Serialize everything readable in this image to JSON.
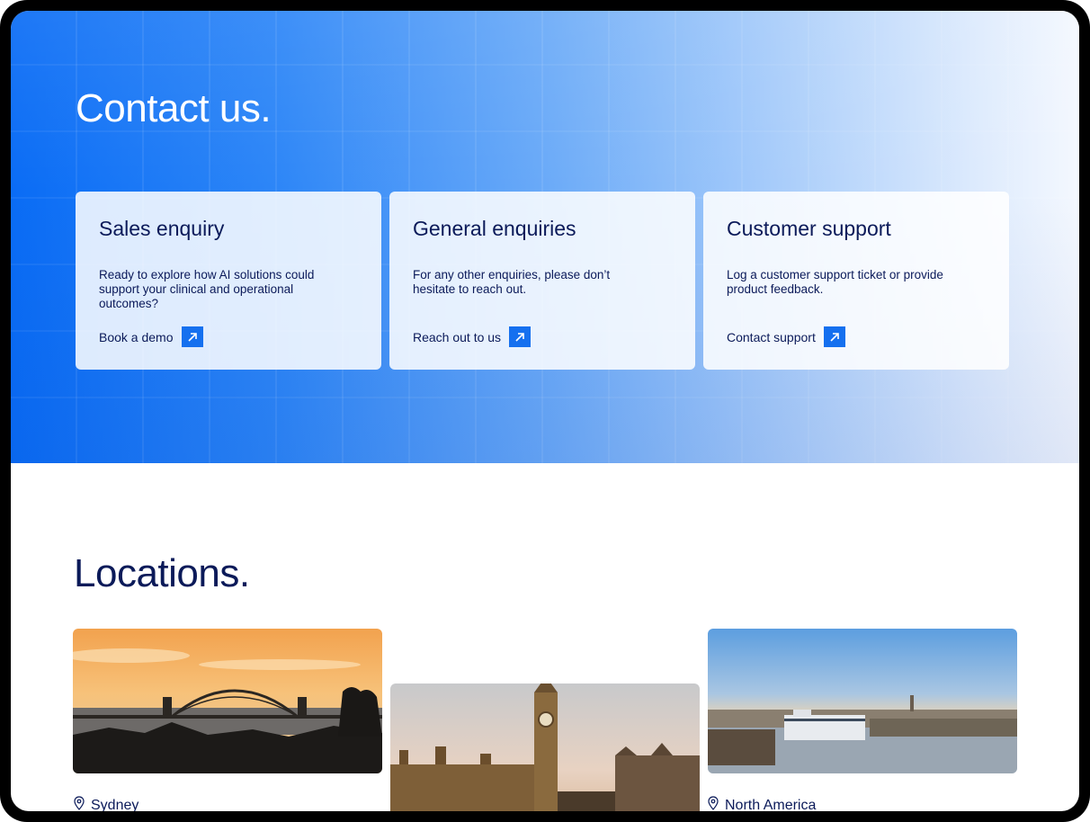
{
  "hero": {
    "title": "Contact us."
  },
  "cards": [
    {
      "title": "Sales enquiry",
      "text": "Ready to explore how AI solutions could support your clinical and operational outcomes?",
      "link": "Book a demo",
      "icon": "arrow-up-right-icon"
    },
    {
      "title": "General enquiries",
      "text": "For any other enquiries, please don’t hesitate to reach out.",
      "link": "Reach out to us",
      "icon": "arrow-up-right-icon"
    },
    {
      "title": "Customer support",
      "text": "Log a customer support ticket or provide product feedback.",
      "link": "Contact support",
      "icon": "arrow-up-right-icon"
    }
  ],
  "locations": {
    "title": "Locations.",
    "items": [
      {
        "name": "Sydney",
        "icon": "map-pin-icon"
      },
      {
        "name": "North America",
        "icon": "map-pin-icon"
      }
    ]
  },
  "colors": {
    "accent": "#1570ef",
    "navy": "#0b1a59"
  }
}
